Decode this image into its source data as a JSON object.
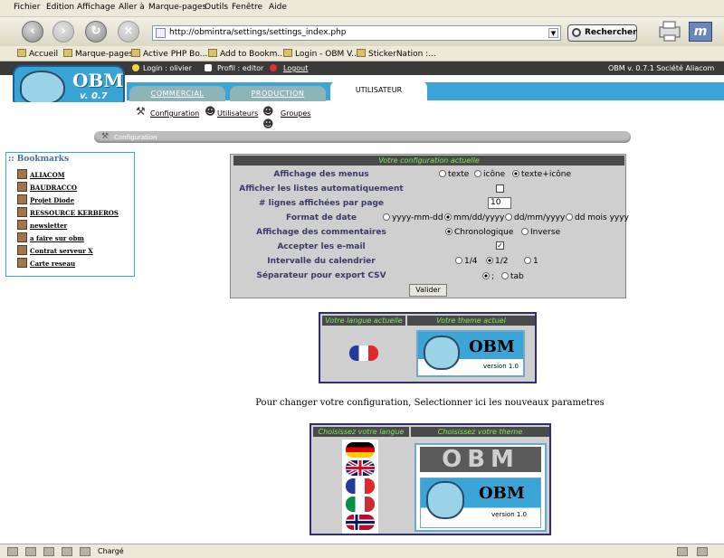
{
  "browser": {
    "menu": [
      "Fichier",
      "Edition",
      "Affichage",
      "Aller à",
      "Marque-pages",
      "Outils",
      "Fenêtre",
      "Aide"
    ],
    "url": "http://obmintra/settings/settings_index.php",
    "search_label": "Rechercher",
    "bookmarks": [
      "Accueil",
      "Marque-pages",
      "Active PHP Bo...",
      "Add to Bookm...",
      "Login - OBM V...",
      "StickerNation :..."
    ],
    "status": "Chargé"
  },
  "obm": {
    "login": "Login : olivier",
    "profile": "Profil : editor",
    "logout": "Logout",
    "version_info": "OBM v. 0.7.1  Société Aliacom",
    "logo_text": "OBM",
    "logo_version": "v. 0.7",
    "tabs": [
      "COMMERCIAL",
      "PRODUCTION",
      "UTILISATEUR"
    ],
    "subnav": [
      "Configuration",
      "Utilisateurs",
      "Groupes"
    ],
    "crumb": "Configuration"
  },
  "bookmarks_panel": {
    "title": ":: Bookmarks",
    "items": [
      "ALIACOM",
      "BAUDRACCO",
      "Projet Diode",
      "RESSOURCE KERBEROS",
      "newsletter",
      "a faire sur obm",
      "Contrat serveur X",
      "Carte reseau"
    ]
  },
  "config": {
    "header": "Votre configuration actuelle",
    "rows": {
      "menus": "Affichage des menus",
      "autolist": "Afficher les listes automatiquement",
      "lines": "# lignes affichées par page",
      "dateformat": "Format de date",
      "comments": "Affichage des commentaires",
      "email": "Accepter les e-mail",
      "calendar": "Intervalle du calendrier",
      "csv": "Séparateur pour export CSV"
    },
    "menu_options": [
      "texte",
      "icône",
      "texte+icône"
    ],
    "lines_value": "10",
    "date_options": [
      "yyyy-mm-dd",
      "mm/dd/yyyy",
      "dd/mm/yyyy",
      "dd mois yyyy"
    ],
    "comment_options": [
      "Chronologique",
      "Inverse"
    ],
    "calendar_options": [
      "1/4",
      "1/2",
      "1"
    ],
    "csv_options": [
      ";",
      "tab"
    ],
    "submit": "Valider"
  },
  "current": {
    "lang_header": "Votre langue actuelle",
    "theme_header": "Votre theme actuel",
    "theme_logo": "OBM",
    "theme_version": "version 1.0"
  },
  "change_msg": "Pour changer votre configuration, Selectionner ici les nouveaux parametres",
  "choose": {
    "lang_header": "Choisissez votre langue",
    "theme_header": "Choisissez votre theme",
    "theme1_logo": "OBM",
    "theme2_logo": "OBM",
    "theme2_version": "version 1.0"
  }
}
